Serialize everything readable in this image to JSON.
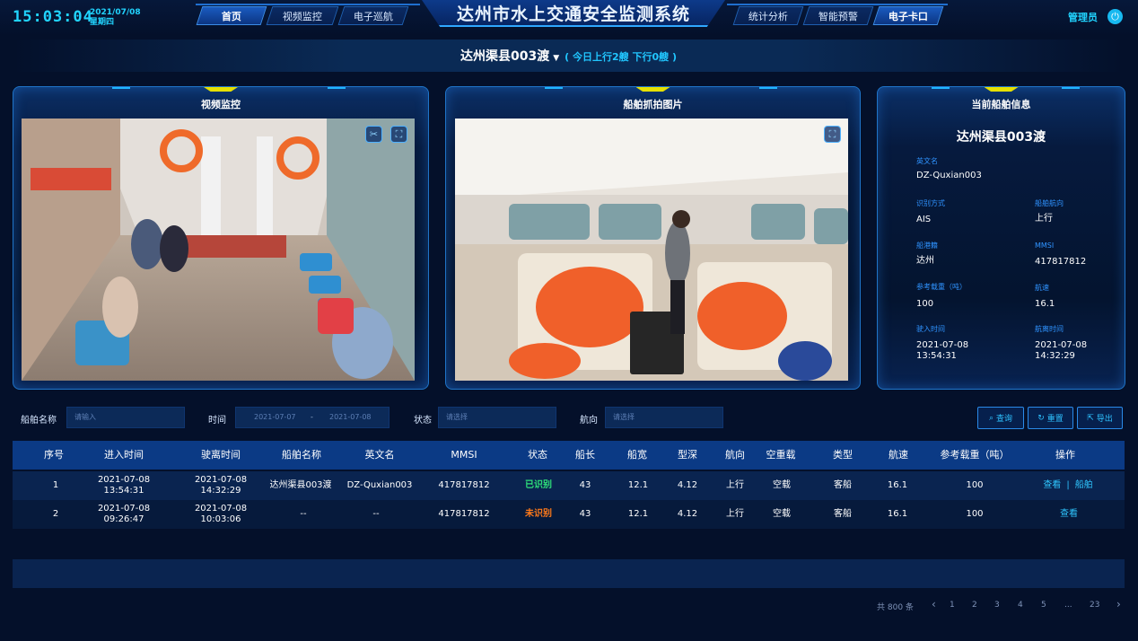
{
  "header": {
    "time": "15:03:04",
    "date": "2021/07/08",
    "weekday": "星期四",
    "title": "达州市水上交通安全监测系统",
    "nav_left": [
      "首页",
      "视频监控",
      "电子巡航"
    ],
    "nav_right": [
      "统计分析",
      "智能预警",
      "电子卡口"
    ],
    "user": "管理员"
  },
  "ferry": {
    "name": "达州渠县003渡",
    "stats": "( 今日上行2艘  下行0艘 )"
  },
  "panels": {
    "video_title": "视频监控",
    "capture_title": "船舶抓拍图片",
    "info_title": "当前船舶信息"
  },
  "ship_info": {
    "name": "达州渠县003渡",
    "english_label": "英文名",
    "english_value": "DZ-Quxian003",
    "ident_label": "识别方式",
    "ident_value": "AIS",
    "direction_label": "船舶航向",
    "direction_value": "上行",
    "port_label": "船港籍",
    "port_value": "达州",
    "mmsi_label": "MMSI",
    "mmsi_value": "417817812",
    "load_label": "参考载重（吨）",
    "load_value": "100",
    "speed_label": "航速",
    "speed_value": "16.1",
    "enter_label": "驶入时间",
    "enter_date": "2021-07-08",
    "enter_time": "13:54:31",
    "leave_label": "航离时间",
    "leave_date": "2021-07-08",
    "leave_time": "14:32:29"
  },
  "filters": {
    "ship_label": "船舶名称",
    "ship_placeholder": "请输入",
    "time_label": "时间",
    "date_start": "2021-07-07",
    "date_sep": "-",
    "date_end": "2021-07-08",
    "status_label": "状态",
    "status_placeholder": "请选择",
    "direction_label": "航向",
    "direction_placeholder": "请选择",
    "query_btn": "查询",
    "reset_btn": "重置",
    "export_btn": "导出"
  },
  "table": {
    "headers": [
      "序号",
      "进入时间",
      "驶离时间",
      "船舶名称",
      "英文名",
      "MMSI",
      "状态",
      "船长",
      "船宽",
      "型深",
      "航向",
      "空重载",
      "类型",
      "航速",
      "参考载重（吨）",
      "操作"
    ],
    "rows": [
      {
        "no": "1",
        "enter_date": "2021-07-08",
        "enter_time": "13:54:31",
        "leave_date": "2021-07-08",
        "leave_time": "14:32:29",
        "name": "达州渠县003渡",
        "en": "DZ-Quxian003",
        "mmsi": "417817812",
        "status": "已识别",
        "length": "43",
        "width": "12.1",
        "depth": "4.12",
        "direction": "上行",
        "load_state": "空载",
        "type": "客船",
        "speed": "16.1",
        "load": "100",
        "op1": "查看",
        "op_sep": "|",
        "op2": "船舶"
      },
      {
        "no": "2",
        "enter_date": "2021-07-08",
        "enter_time": "09:26:47",
        "leave_date": "2021-07-08",
        "leave_time": "10:03:06",
        "name": "--",
        "en": "--",
        "mmsi": "417817812",
        "status": "未识别",
        "length": "43",
        "width": "12.1",
        "depth": "4.12",
        "direction": "上行",
        "load_state": "空载",
        "type": "客船",
        "speed": "16.1",
        "load": "100",
        "op1": "查看"
      }
    ]
  },
  "pager": {
    "total": "共 800 条",
    "prev": "‹",
    "pages": [
      "1",
      "2",
      "3",
      "4",
      "5",
      "...",
      "23"
    ],
    "next": "›"
  }
}
